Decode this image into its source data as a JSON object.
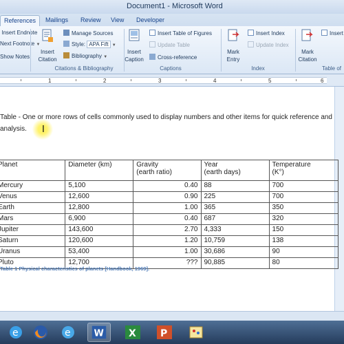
{
  "window": {
    "title": "Document1 - Microsoft Word"
  },
  "tabs": [
    {
      "label": "References",
      "active": true
    },
    {
      "label": "Mailings",
      "active": false
    },
    {
      "label": "Review",
      "active": false
    },
    {
      "label": "View",
      "active": false
    },
    {
      "label": "Developer",
      "active": false
    }
  ],
  "ribbon": {
    "insert_endnote": "Insert Endnote",
    "next_footnote": "Next Footnote",
    "show_notes": "Show Notes",
    "insert_citation": "Insert Citation",
    "manage_sources": "Manage Sources",
    "style_label": "Style:",
    "style_value": "APA Fift",
    "bibliography": "Bibliography",
    "group_citations": "Citations & Bibliography",
    "insert_caption": "Insert Caption",
    "insert_table_of_figures": "Insert Table of Figures",
    "update_table": "Update Table",
    "cross_reference": "Cross-reference",
    "group_captions": "Captions",
    "mark_entry": "Mark Entry",
    "insert_index": "Insert Index",
    "update_index": "Update Index",
    "group_index": "Index",
    "mark_citation": "Mark Citation",
    "insert_table_of_authorities_partial": "Insert",
    "group_table_of_authorities_partial": "Table of"
  },
  "ruler": {
    "numbers": [
      "1",
      "2",
      "3",
      "4",
      "5",
      "6"
    ]
  },
  "document": {
    "definition_line1": "Table - One or more rows of cells commonly used to display numbers and other items for quick reference and",
    "definition_line2": "analysis.",
    "table": {
      "headers": [
        [
          "Planet",
          ""
        ],
        [
          "Diameter (km)",
          ""
        ],
        [
          "Gravity",
          "(earth ratio)"
        ],
        [
          "Year",
          "(earth days)"
        ],
        [
          "Temperature",
          "(K°)"
        ]
      ],
      "rows": [
        [
          "Mercury",
          "5,100",
          "0.40",
          "88",
          "700"
        ],
        [
          "Venus",
          "12,600",
          "0.90",
          "225",
          "700"
        ],
        [
          "Earth",
          "12,800",
          "1.00",
          "365",
          "350"
        ],
        [
          "Mars",
          "6,900",
          "0.40",
          "687",
          "320"
        ],
        [
          "Jupiter",
          "143,600",
          "2.70",
          "4,333",
          "150"
        ],
        [
          "Saturn",
          "120,600",
          "1.20",
          "10,759",
          "138"
        ],
        [
          "Uranus",
          "53,400",
          "1.00",
          "30,686",
          "90"
        ],
        [
          "Pluto",
          "12,700",
          "???",
          "90,885",
          "80"
        ]
      ]
    },
    "caption": "Table 1  Physical characteristics of planets [Handbook, 1969]."
  },
  "taskbar": {
    "items": [
      "ie-icon",
      "firefox-icon",
      "ie-icon-2",
      "word-icon",
      "excel-icon",
      "powerpoint-icon",
      "paint-icon"
    ]
  },
  "colors": {
    "accent": "#15428b",
    "caption": "#4a78b5",
    "taskbar": "#2f4a6d"
  }
}
